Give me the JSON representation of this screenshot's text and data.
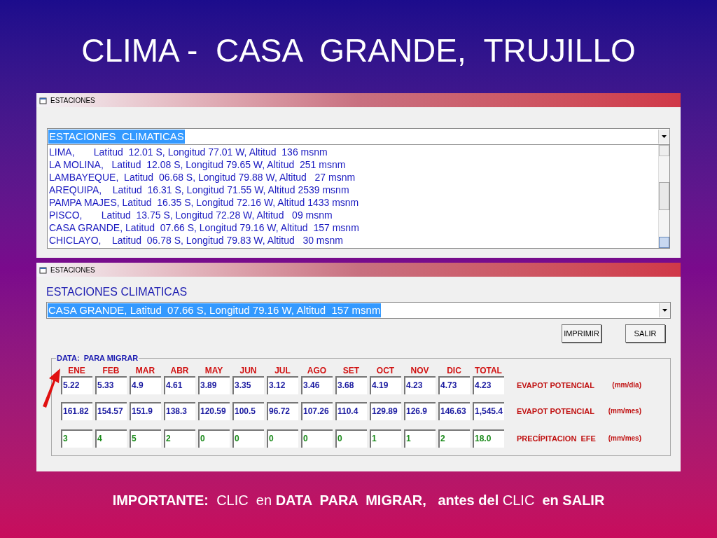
{
  "title": "CLIMA -  CASA  GRANDE,  TRUJILLO",
  "windows": [
    {
      "kind": "list",
      "title": "ESTACIONES",
      "combo": {
        "value": "ESTACIONES  CLIMATICAS",
        "selected": true
      },
      "items": [
        "LIMA,       Latitud  12.01 S, Longitud 77.01 W, Altitud  136 msnm",
        "LA MOLINA,   Latitud  12.08 S, Longitud 79.65 W, Altitud  251 msnm",
        "LAMBAYEQUE,  Latitud  06.68 S, Longitud 79.88 W, Altitud   27 msnm",
        "AREQUIPA,    Latitud  16.31 S, Longitud 71.55 W, Altitud 2539 msnm",
        "PAMPA MAJES, Latitud  16.35 S, Longitud 72.16 W, Altitud 1433 msnm",
        "PISCO,       Latitud  13.75 S, Longitud 72.28 W, Altitud   09 msnm",
        "CASA GRANDE, Latitud  07.66 S, Longitud 79.16 W, Altitud  157 msnm",
        "CHICLAYO,    Latitud  06.78 S, Longitud 79.83 W, Altitud   30 msnm"
      ]
    },
    {
      "kind": "form",
      "title": "ESTACIONES",
      "label": "ESTACIONES CLIMATICAS",
      "combo": {
        "value": "CASA GRANDE, Latitud  07.66 S, Longitud 79.16 W, Altitud  157 msnm",
        "selected": true
      },
      "buttons": [
        "IMPRIMIR",
        "SALIR"
      ],
      "group": {
        "legend": "DATA:  PARA MIGRAR",
        "columns": [
          "ENE",
          "FEB",
          "MAR",
          "ABR",
          "MAY",
          "JUN",
          "JUL",
          "AGO",
          "SET",
          "OCT",
          "NOV",
          "DIC",
          "TOTAL"
        ],
        "rows": [
          {
            "color": "#1a1aa0",
            "values": [
              "5.22",
              "5.33",
              "4.9",
              "4.61",
              "3.89",
              "3.35",
              "3.12",
              "3.46",
              "3.68",
              "4.19",
              "4.23",
              "4.73",
              "4.23"
            ],
            "label": "EVAPOT POTENCIAL",
            "unit": "(mm/dia)"
          },
          {
            "color": "#1a1aa0",
            "values": [
              "161.82",
              "154.57",
              "151.9",
              "138.3",
              "120.59",
              "100.5",
              "96.72",
              "107.26",
              "110.4",
              "129.89",
              "126.9",
              "146.63",
              "1,545.4"
            ],
            "label": "EVAPOT POTENCIAL",
            "unit": "(mm/mes)"
          },
          {
            "color": "#1a8a1a",
            "values": [
              "3",
              "4",
              "5",
              "2",
              "0",
              "0",
              "0",
              "0",
              "0",
              "1",
              "1",
              "2",
              "18.0"
            ],
            "label": "PRECÍPITACION  EFE",
            "unit": "(mm/mes)"
          }
        ]
      }
    }
  ],
  "footer": "**IMPORTANTE:**  CLIC  en **DATA  PARA  MIGRAR,   antes del** CLIC  **en SALIR**"
}
